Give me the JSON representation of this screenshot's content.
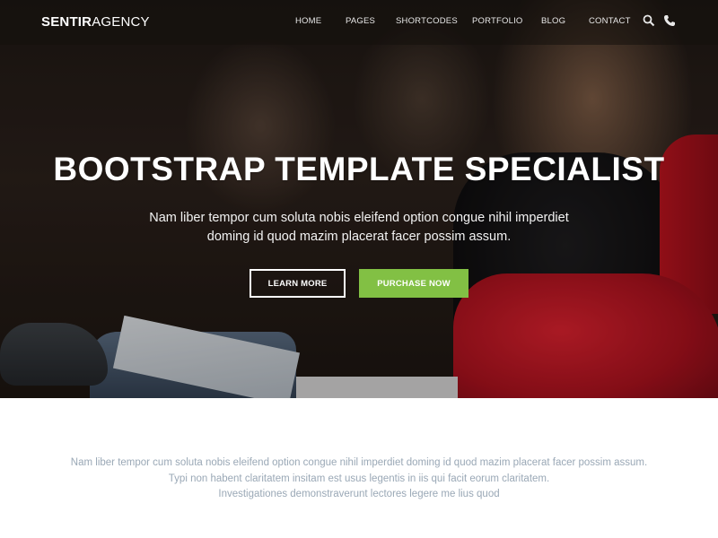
{
  "brand": {
    "name_bold": "SENTIR",
    "name_light": "AGENCY"
  },
  "nav": {
    "items": [
      "HOME",
      "PAGES",
      "SHORTCODES",
      "PORTFOLIO",
      "BLOG",
      "CONTACT"
    ],
    "icons": [
      "search-icon",
      "phone-icon"
    ]
  },
  "hero": {
    "title": "BOOTSTRAP TEMPLATE SPECIALIST",
    "subtitle_line1": "Nam liber tempor cum soluta nobis eleifend option congue nihil imperdiet",
    "subtitle_line2": "doming id quod mazim placerat facer possim assum.",
    "primary_button": "LEARN MORE",
    "secondary_button": "PURCHASE NOW"
  },
  "intro": {
    "line1": "Nam liber tempor cum soluta nobis eleifend option congue nihil imperdiet doming id quod mazim placerat facer possim assum.",
    "line2": "Typi non habent claritatem insitam est usus legentis in iis qui facit eorum claritatem.",
    "line3": "Investigationes demonstraverunt lectores legere me lius quod"
  },
  "colors": {
    "accent_green": "#82c044",
    "intro_text": "#9aa8b6",
    "chair_red": "#d0141f"
  }
}
